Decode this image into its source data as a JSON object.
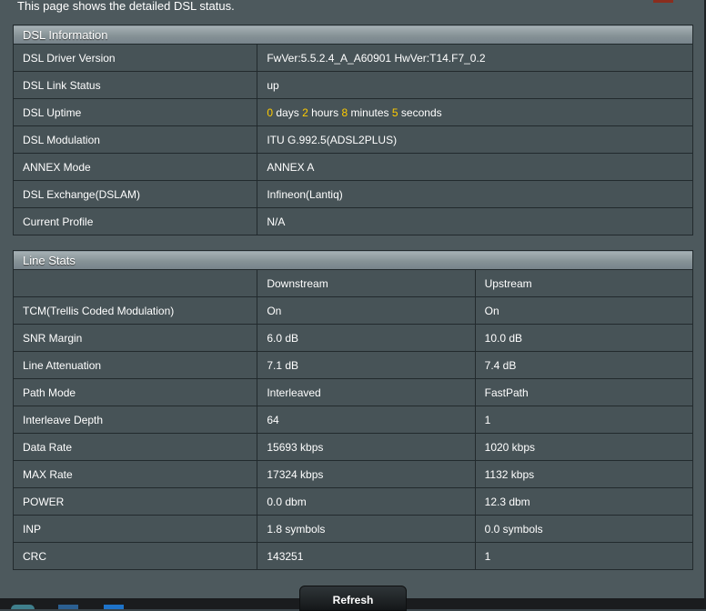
{
  "intro_text": "This page shows the detailed DSL status.",
  "dsl_info": {
    "title": "DSL Information",
    "rows": [
      {
        "label": "DSL Driver Version",
        "value": "FwVer:5.5.2.4_A_A60901 HwVer:T14.F7_0.2"
      },
      {
        "label": "DSL Link Status",
        "value": "up"
      },
      {
        "label": "DSL Uptime",
        "value": ""
      },
      {
        "label": "DSL Modulation",
        "value": "ITU G.992.5(ADSL2PLUS)"
      },
      {
        "label": "ANNEX Mode",
        "value": "ANNEX A"
      },
      {
        "label": "DSL Exchange(DSLAM)",
        "value": "Infineon(Lantiq)"
      },
      {
        "label": "Current Profile",
        "value": "N/A"
      }
    ],
    "uptime": {
      "days": "0",
      "days_label": "days",
      "hours": "2",
      "hours_label": "hours",
      "minutes": "8",
      "minutes_label": "minutes",
      "seconds": "5",
      "seconds_label": "seconds"
    }
  },
  "line_stats": {
    "title": "Line Stats",
    "col_downstream": "Downstream",
    "col_upstream": "Upstream",
    "rows": [
      {
        "label": "TCM(Trellis Coded Modulation)",
        "down": "On",
        "up": "On"
      },
      {
        "label": "SNR Margin",
        "down": "6.0 dB",
        "up": "10.0 dB"
      },
      {
        "label": "Line Attenuation",
        "down": "7.1 dB",
        "up": "7.4 dB"
      },
      {
        "label": "Path Mode",
        "down": "Interleaved",
        "up": "FastPath"
      },
      {
        "label": "Interleave Depth",
        "down": "64",
        "up": "1"
      },
      {
        "label": "Data Rate",
        "down": "15693 kbps",
        "up": "1020 kbps"
      },
      {
        "label": "MAX Rate",
        "down": "17324 kbps",
        "up": "1132 kbps"
      },
      {
        "label": "POWER",
        "down": "0.0 dbm",
        "up": "12.3 dbm"
      },
      {
        "label": "INP",
        "down": "1.8 symbols",
        "up": "0.0 symbols"
      },
      {
        "label": "CRC",
        "down": "143251",
        "up": "1"
      }
    ]
  },
  "refresh_label": "Refresh",
  "colors": {
    "highlight": "#ffcc00",
    "panel_bg": "#475357",
    "header_bg": "#869296"
  },
  "taskbar_icons": [
    "start-orb-icon",
    "window-icon",
    "app-icon"
  ]
}
